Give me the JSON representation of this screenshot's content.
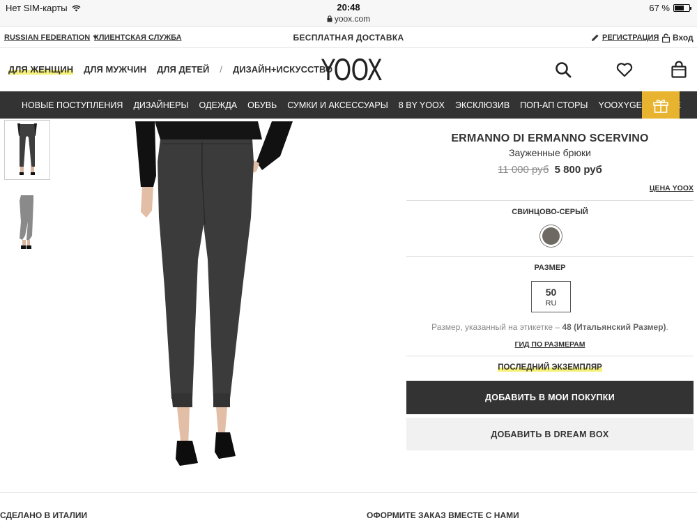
{
  "status_bar": {
    "carrier": "Нет SIM-карты",
    "time": "20:48",
    "url": "yoox.com",
    "battery": "67 %",
    "battery_level": 0.67
  },
  "utility_bar": {
    "country": "RUSSIAN FEDERATION",
    "customer_service": "КЛИЕНТСКАЯ СЛУЖБА",
    "free_shipping": "БЕСПЛАТНАЯ ДОСТАВКА",
    "register": "РЕГИСТРАЦИЯ",
    "login": "Вход"
  },
  "header": {
    "categories": [
      "ДЛЯ ЖЕНЩИН",
      "ДЛЯ МУЖЧИН",
      "ДЛЯ ДЕТЕЙ",
      "ДИЗАЙН+ИСКУССТВО"
    ],
    "separator": "/",
    "logo": "YOOX",
    "icons": [
      "search-icon",
      "heart-icon",
      "shopping-bag-icon"
    ]
  },
  "menu": {
    "items": [
      "НОВЫЕ ПОСТУПЛЕНИЯ",
      "ДИЗАЙНЕРЫ",
      "ОДЕЖДА",
      "ОБУВЬ",
      "СУМКИ И АКСЕССУАРЫ",
      "8 BY YOOX",
      "ЭКСКЛЮЗИВ",
      "ПОП-АП СТОРЫ",
      "YOOXYGEN",
      "SALE"
    ],
    "gift_icon": "gift-icon",
    "gift_color": "#e8b32e"
  },
  "product": {
    "brand": "ERMANNO DI ERMANNO SCERVINO",
    "name": "Зауженные брюки",
    "old_price": "11 000 руб",
    "price": "5 800 руб",
    "price_link": "ЦЕНА YOOX",
    "color_label": "СВИНЦОВО-СЕРЫЙ",
    "color_hex": "#6e6a63",
    "size_label": "РАЗМЕР",
    "size_value": "50",
    "size_unit": "RU",
    "size_note_prefix": "Размер, указанный на этикетке –",
    "size_note_bold": "48 (Итальянский Размер)",
    "size_note_suffix": ".",
    "size_guide": "ГИД ПО РАЗМЕРАМ",
    "last_item": "ПОСЛЕДНИЙ ЭКЗЕМПЛЯР",
    "add_to_cart": "ДОБАВИТЬ В МОИ ПОКУПКИ",
    "add_to_dreambox": "ДОБАВИТЬ В DREAM BOX"
  },
  "footer": {
    "made_in": "СДЕЛАНО В ИТАЛИИ",
    "order_together": "ОФОРМИТЕ ЗАКАЗ ВМЕСТЕ С НАМИ"
  }
}
